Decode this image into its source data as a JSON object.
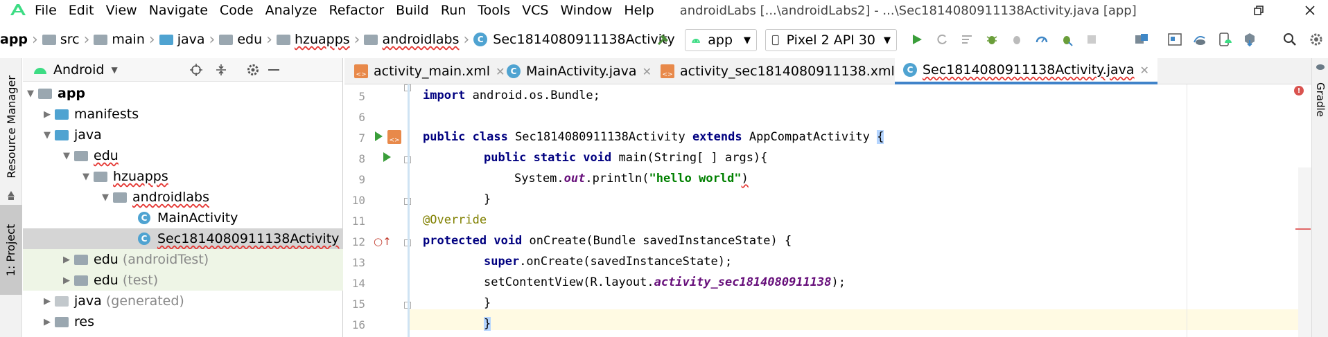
{
  "menubar": {
    "items": [
      "File",
      "Edit",
      "View",
      "Navigate",
      "Code",
      "Analyze",
      "Refactor",
      "Build",
      "Run",
      "Tools",
      "VCS",
      "Window",
      "Help"
    ],
    "title": "androidLabs [...\\androidLabs2] - ...\\Sec1814080911138Activity.java [app]"
  },
  "breadcrumb": {
    "items": [
      "app",
      "src",
      "main",
      "java",
      "edu",
      "hzuapps",
      "androidlabs",
      "Sec1814080911138Activity"
    ]
  },
  "toolbar": {
    "run_config": "app",
    "device": "Pixel 2 API 30"
  },
  "side_tabs": {
    "resource_manager": "Resource Manager",
    "project": "1: Project",
    "gradle": "Gradle"
  },
  "project_panel": {
    "view_mode": "Android",
    "tree": [
      {
        "label": "app",
        "depth": 0,
        "expanded": true,
        "icon": "module"
      },
      {
        "label": "manifests",
        "depth": 1,
        "expanded": false,
        "icon": "folder"
      },
      {
        "label": "java",
        "depth": 1,
        "expanded": true,
        "icon": "folder"
      },
      {
        "label": "edu",
        "depth": 2,
        "expanded": true,
        "icon": "package"
      },
      {
        "label": "hzuapps",
        "depth": 3,
        "expanded": true,
        "icon": "package"
      },
      {
        "label": "androidlabs",
        "depth": 4,
        "expanded": true,
        "icon": "package"
      },
      {
        "label": "MainActivity",
        "depth": 5,
        "icon": "class"
      },
      {
        "label": "Sec1814080911138Activity",
        "depth": 5,
        "icon": "class",
        "selected": true
      },
      {
        "label": "edu",
        "suffix": "(androidTest)",
        "depth": 2,
        "expanded": false,
        "icon": "package"
      },
      {
        "label": "edu",
        "suffix": "(test)",
        "depth": 2,
        "expanded": false,
        "icon": "package"
      },
      {
        "label": "java",
        "suffix": "(generated)",
        "depth": 1,
        "expanded": false,
        "icon": "folder-gen"
      },
      {
        "label": "res",
        "depth": 1,
        "expanded": false,
        "icon": "folder"
      }
    ]
  },
  "editor_tabs": [
    {
      "label": "activity_main.xml",
      "icon": "xml-icon",
      "active": false
    },
    {
      "label": "MainActivity.java",
      "icon": "class-icon",
      "active": false
    },
    {
      "label": "activity_sec1814080911138.xml",
      "icon": "xml-icon",
      "active": false
    },
    {
      "label": "Sec1814080911138Activity.java",
      "icon": "class-icon",
      "active": true
    }
  ],
  "editor": {
    "line_numbers": [
      "5",
      "6",
      "7",
      "8",
      "9",
      "10",
      "11",
      "12",
      "13",
      "14",
      "15",
      "16"
    ],
    "lines": {
      "l5_kw": "import",
      "l5_rest": " android.os.Bundle;",
      "l7_kw1": "public class",
      "l7_name": " Sec1814080911138Activity ",
      "l7_kw2": "extends",
      "l7_rest": " AppCompatActivity ",
      "l7_brace": "{",
      "l8_kw": "public static void",
      "l8_rest": " main(String[ ] args){",
      "l9_pre": "System.",
      "l9_fld": "out",
      "l9_mid": ".println(",
      "l9_str": "\"hello world\"",
      "l9_end": ")",
      "l10": "}",
      "l11": "@Override",
      "l12_kw": "protected void",
      "l12_rest": " onCreate(Bundle savedInstanceState) {",
      "l13_kw": "super",
      "l13_rest": ".onCreate(savedInstanceState);",
      "l14_pre": "setContentView(R.layout.",
      "l14_fld": "activity_sec1814080911138",
      "l14_end": ");",
      "l15": "}",
      "l16": "}"
    }
  },
  "colors": {
    "keyword": "#000080",
    "string": "#008000",
    "annotation": "#808000",
    "field": "#660e7a",
    "accent": "#4083c9",
    "selection": "#d5d5d5",
    "test_bg": "#eef5e6",
    "current_line": "#fffae3"
  }
}
